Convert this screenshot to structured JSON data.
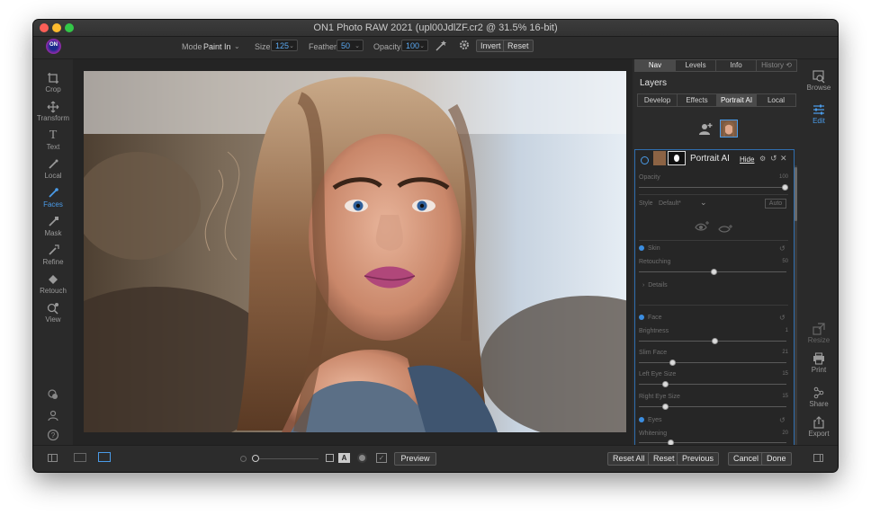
{
  "window": {
    "title": "ON1 Photo RAW 2021 (upl00JdlZF.cr2 @ 31.5% 16-bit)"
  },
  "logo": {
    "text": "ON"
  },
  "toolbar": {
    "mode_label": "Mode",
    "mode_value": "Paint In",
    "size_label": "Size",
    "size_value": "125",
    "feather_label": "Feather",
    "feather_value": "50",
    "opacity_label": "Opacity",
    "opacity_value": "100",
    "invert_label": "Invert",
    "reset_label": "Reset"
  },
  "left_tools": [
    {
      "label": "Crop",
      "icon": "crop-icon"
    },
    {
      "label": "Transform",
      "icon": "move-icon"
    },
    {
      "label": "Text",
      "icon": "text-icon"
    },
    {
      "label": "Local",
      "icon": "brush-icon"
    },
    {
      "label": "Faces",
      "icon": "face-brush-icon",
      "active": true
    },
    {
      "label": "Mask",
      "icon": "mask-brush-icon"
    },
    {
      "label": "Refine",
      "icon": "refine-brush-icon"
    },
    {
      "label": "Retouch",
      "icon": "retouch-icon"
    },
    {
      "label": "View",
      "icon": "zoom-icon"
    }
  ],
  "panel": {
    "tabs": [
      "Nav",
      "Levels",
      "Info",
      "History"
    ],
    "title": "Layers",
    "subtabs": [
      "Develop",
      "Effects",
      "Portrait AI",
      "Local"
    ],
    "layer": {
      "name": "Portrait AI",
      "hide_label": "Hide",
      "opacity_label": "Opacity",
      "opacity_value": "100",
      "style_label": "Style",
      "style_value": "Default*",
      "auto_label": "Auto",
      "skin_label": "Skin",
      "retouching_label": "Retouching",
      "retouching_value": "50",
      "details_label": "Details",
      "face_label": "Face",
      "brightness_label": "Brightness",
      "brightness_value": "1",
      "slim_face_label": "Slim Face",
      "slim_face_value": "21",
      "left_eye_label": "Left Eye Size",
      "left_eye_value": "15",
      "right_eye_label": "Right Eye Size",
      "right_eye_value": "15",
      "eyes_label": "Eyes",
      "whitening_label": "Whitening",
      "whitening_value": "20"
    }
  },
  "right_tools": [
    {
      "label": "Browse",
      "icon": "browse-icon"
    },
    {
      "label": "Edit",
      "icon": "sliders-icon",
      "active": true
    },
    {
      "label": "Resize",
      "icon": "resize-icon"
    },
    {
      "label": "Print",
      "icon": "print-icon"
    },
    {
      "label": "Share",
      "icon": "share-icon"
    },
    {
      "label": "Export",
      "icon": "export-icon"
    }
  ],
  "bottom": {
    "a_label": "A",
    "preview_label": "Preview",
    "reset_all_label": "Reset All",
    "reset_label": "Reset",
    "previous_label": "Previous",
    "cancel_label": "Cancel",
    "done_label": "Done"
  },
  "colors": {
    "accent": "#4a9be8",
    "panel_bg": "#2a2a2a",
    "card_border": "#2f6fb0"
  }
}
